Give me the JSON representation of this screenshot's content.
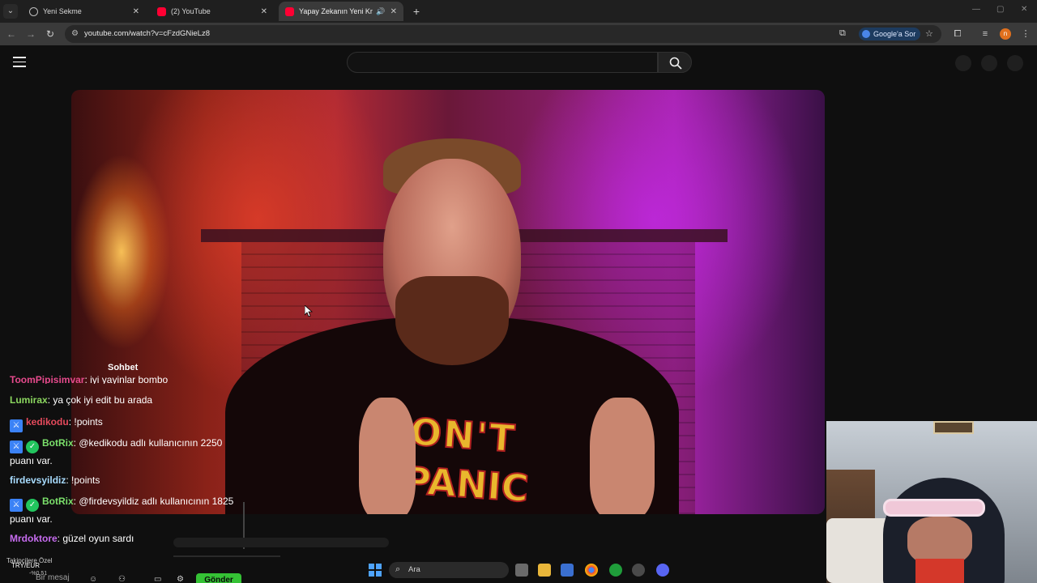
{
  "browser": {
    "tabs": [
      {
        "title": "Yeni Sekme",
        "icon": "globe-icon",
        "active": false
      },
      {
        "title": "(2) YouTube",
        "icon": "youtube-icon",
        "active": false
      },
      {
        "title": "Yapay Zekanın Yeni Kralı Cl",
        "icon": "youtube-icon",
        "active": true
      }
    ],
    "url": "youtube.com/watch?v=cFzdGNieLz8",
    "ask_google_label": "Google'a Sor",
    "profile_initial": "n"
  },
  "youtube": {
    "search_placeholder": ""
  },
  "chat": {
    "title": "Sohbet",
    "messages": [
      {
        "user": "ToomPipisimvar",
        "text": ": iyi yayinlar bombo",
        "color": "#e54a8c",
        "badges": []
      },
      {
        "user": "Lumirax",
        "text": ": ya çok iyi edit bu arada",
        "color": "#8bd65f",
        "badges": []
      },
      {
        "user": "kedikodu",
        "text": ": !points",
        "color": "#e54a5c",
        "badges": [
          "mod"
        ]
      },
      {
        "user": "BotRix",
        "text": ": @kedikodu adlı kullanıcının 2250 puanı var.",
        "color": "#7be06b",
        "badges": [
          "mod",
          "verified"
        ]
      },
      {
        "user": "firdevsyildiz",
        "text": ": !points",
        "color": "#a8dcff",
        "badges": []
      },
      {
        "user": "BotRix",
        "text": ": @firdevsyildiz adlı kullanıcının 1825 puanı var.",
        "color": "#7be06b",
        "badges": [
          "mod",
          "verified"
        ]
      },
      {
        "user": "Mrdoktore",
        "text": ": güzel oyun sardı",
        "color": "#c76cf0",
        "badges": []
      }
    ],
    "footer_label": "Takipçilere Özel",
    "input_placeholder": "Bir mesaj",
    "send_label": "Gönder"
  },
  "taskbar": {
    "search_label": "Ara",
    "weather": "TRY/EUR",
    "weather_sub": "-%0,51"
  },
  "video": {
    "shirt_line1": "DON'T",
    "shirt_line2": "PANIC"
  },
  "colors": {
    "accent_blue": "#3b82f6",
    "verified_green": "#22c55e",
    "send_green": "#35c235",
    "youtube_red": "#ff0033"
  }
}
